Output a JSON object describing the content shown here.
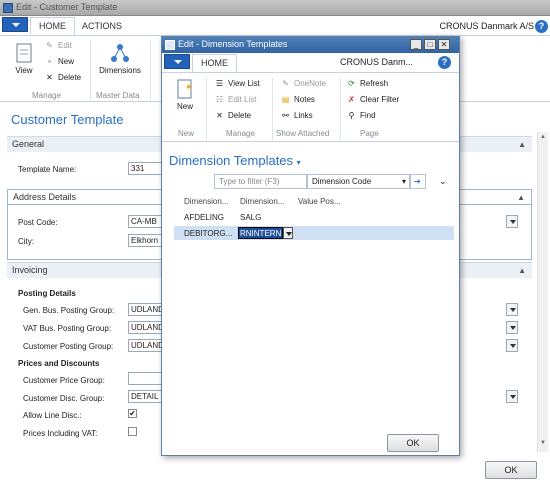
{
  "main_window": {
    "title": "Edit - Customer Template",
    "tabs": [
      "HOME",
      "ACTIONS"
    ],
    "company": "CRONUS Danmark A/S",
    "ribbon": {
      "manage": {
        "view": "View",
        "edit": "Edit",
        "new": "New",
        "delete": "Delete",
        "group": "Manage"
      },
      "master_data": {
        "dimensions": "Dimensions",
        "group": "Master Data"
      }
    },
    "page_title": "Customer Template",
    "sections": {
      "general": "General",
      "address": "Address Details",
      "invoicing": "Invoicing"
    },
    "fields": {
      "template_name_label": "Template Name:",
      "template_name_value": "331",
      "post_code_label": "Post Code:",
      "post_code_value": "CA-MB",
      "city_label": "City:",
      "city_value": "Elkhorn",
      "posting_details": "Posting Details",
      "gen_bus_label": "Gen. Bus. Posting Group:",
      "gen_bus_value": "UDLAND",
      "vat_bus_label": "VAT Bus. Posting Group:",
      "vat_bus_value": "UDLAND",
      "cust_posting_label": "Customer Posting Group:",
      "cust_posting_value": "UDLAND",
      "prices_discounts": "Prices and Discounts",
      "cust_price_label": "Customer Price Group:",
      "cust_price_value": "",
      "cust_disc_label": "Customer Disc. Group:",
      "cust_disc_value": "DETAIL",
      "allow_line_disc_label": "Allow Line Disc.:",
      "allow_line_disc_check": "✔",
      "prices_incl_vat_label": "Prices Including VAT:"
    },
    "ok_label": "OK"
  },
  "dialog": {
    "title": "Edit - Dimension Templates",
    "tab": "HOME",
    "company": "CRONUS Danm...",
    "ribbon": {
      "new": "New",
      "new_group": "New",
      "view_list": "View List",
      "edit_list": "Edit List",
      "delete": "Delete",
      "manage_group": "Manage",
      "onenote": "OneNote",
      "notes": "Notes",
      "links": "Links",
      "attached_group": "Show Attached",
      "refresh": "Refresh",
      "clear_filter": "Clear Filter",
      "find": "Find",
      "page_group": "Page"
    },
    "heading": "Dimension Templates",
    "filter_placeholder": "Type to filter (F3)",
    "filter_field": "Dimension Code",
    "columns": [
      "Dimension...",
      "Dimension...",
      "Value Pos..."
    ],
    "rows": [
      {
        "code": "AFDELING",
        "value": "SALG",
        "posting": ""
      },
      {
        "code": "DEBITORG...",
        "value": "RNINTERN",
        "posting": ""
      }
    ],
    "ok_label": "OK"
  },
  "colors": {
    "accent": "#2a6fc4",
    "title_active": "#2f63a3",
    "selection": "#cfe0f3"
  }
}
